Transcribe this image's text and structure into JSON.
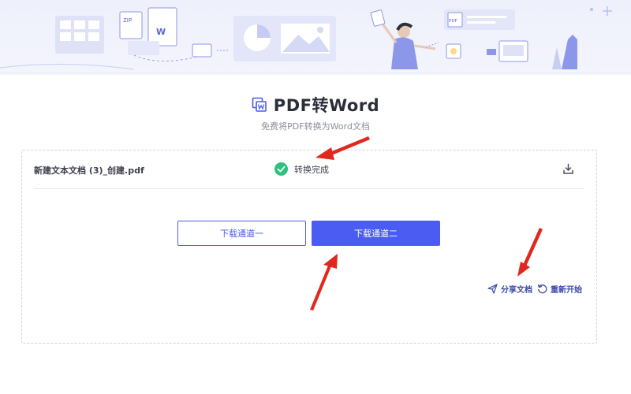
{
  "header": {
    "title": "PDF转Word",
    "subtitle": "免费将PDF转换为Word文档"
  },
  "file": {
    "name": "新建文本文档 (3)_创建.pdf",
    "status": "转换完成"
  },
  "buttons": {
    "channel_one": "下载通道一",
    "channel_two": "下载通道二"
  },
  "actions": {
    "share": "分享文档",
    "restart": "重新开始"
  },
  "banner": {
    "zip_label": "ZIP",
    "pdf_label": "PDF",
    "word_label": "W"
  },
  "colors": {
    "accent": "#4a5cf2",
    "success": "#2ec27e",
    "annotation": "#e0281f"
  }
}
